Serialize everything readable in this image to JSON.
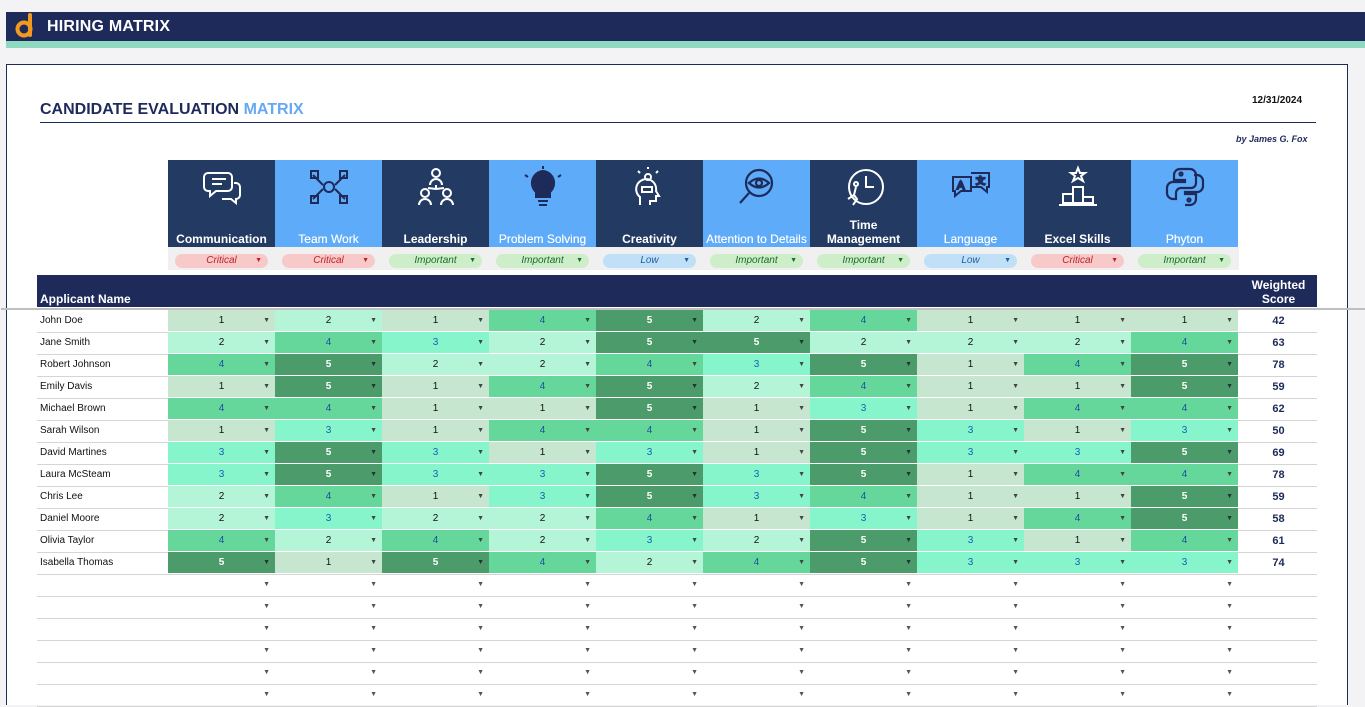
{
  "app": {
    "title": "HIRING MATRIX"
  },
  "sheet": {
    "title_main": "CANDIDATE EVALUATION",
    "title_accent": "MATRIX",
    "date": "12/31/2024",
    "byline": "by James G. Fox",
    "header_applicant": "Applicant Name",
    "header_score_line1": "Weighted",
    "header_score_line2": "Score"
  },
  "criteria": [
    {
      "label": "Communication",
      "priority": "Critical",
      "style": "dark",
      "icon": "speech-bubbles-icon"
    },
    {
      "label": "Team Work",
      "priority": "Critical",
      "style": "light",
      "icon": "handshake-icon"
    },
    {
      "label": "Leadership",
      "priority": "Important",
      "style": "dark",
      "icon": "org-chart-icon"
    },
    {
      "label": "Problem Solving",
      "priority": "Important",
      "style": "light",
      "icon": "puzzle-bulb-icon"
    },
    {
      "label": "Creativity",
      "priority": "Low",
      "style": "dark",
      "icon": "head-idea-icon"
    },
    {
      "label": "Attention to Details",
      "priority": "Important",
      "style": "light",
      "icon": "magnifier-eye-icon"
    },
    {
      "label": "Time Management",
      "priority": "Important",
      "style": "dark",
      "icon": "clock-runner-icon"
    },
    {
      "label": "Language",
      "priority": "Low",
      "style": "light",
      "icon": "translate-icon"
    },
    {
      "label": "Excel Skills",
      "priority": "Critical",
      "style": "dark",
      "icon": "podium-star-icon"
    },
    {
      "label": "Phyton",
      "priority": "Important",
      "style": "light",
      "icon": "python-logo-icon"
    }
  ],
  "applicants": [
    {
      "name": "John Doe",
      "scores": [
        1,
        2,
        1,
        4,
        5,
        2,
        4,
        1,
        1,
        1
      ],
      "weighted": "42"
    },
    {
      "name": "Jane Smith",
      "scores": [
        2,
        4,
        3,
        2,
        5,
        5,
        2,
        2,
        2,
        4
      ],
      "weighted": "63"
    },
    {
      "name": "Robert Johnson",
      "scores": [
        4,
        5,
        2,
        2,
        4,
        3,
        5,
        1,
        4,
        5
      ],
      "weighted": "78"
    },
    {
      "name": "Emily Davis",
      "scores": [
        1,
        5,
        1,
        4,
        5,
        2,
        4,
        1,
        1,
        5
      ],
      "weighted": "59"
    },
    {
      "name": "Michael Brown",
      "scores": [
        4,
        4,
        1,
        1,
        5,
        1,
        3,
        1,
        4,
        4
      ],
      "weighted": "62"
    },
    {
      "name": "Sarah Wilson",
      "scores": [
        1,
        3,
        1,
        4,
        4,
        1,
        5,
        3,
        1,
        3
      ],
      "weighted": "50"
    },
    {
      "name": "David Martines",
      "scores": [
        3,
        5,
        3,
        1,
        3,
        1,
        5,
        3,
        3,
        5
      ],
      "weighted": "69"
    },
    {
      "name": "Laura McSteam",
      "scores": [
        3,
        5,
        3,
        3,
        5,
        3,
        5,
        1,
        4,
        4
      ],
      "weighted": "78"
    },
    {
      "name": "Chris Lee",
      "scores": [
        2,
        4,
        1,
        3,
        5,
        3,
        4,
        1,
        1,
        5
      ],
      "weighted": "59"
    },
    {
      "name": "Daniel Moore",
      "scores": [
        2,
        3,
        2,
        2,
        4,
        1,
        3,
        1,
        4,
        5
      ],
      "weighted": "58"
    },
    {
      "name": "Olivia Taylor",
      "scores": [
        4,
        2,
        4,
        2,
        3,
        2,
        5,
        3,
        1,
        4
      ],
      "weighted": "61"
    },
    {
      "name": "Isabella Thomas",
      "scores": [
        5,
        1,
        5,
        4,
        2,
        4,
        5,
        3,
        3,
        3
      ],
      "weighted": "74"
    }
  ],
  "empty_rows": 6,
  "colors": {
    "navy": "#1e2a5a",
    "accent_blue": "#66a9f2",
    "mint": "#8ed9c0"
  }
}
